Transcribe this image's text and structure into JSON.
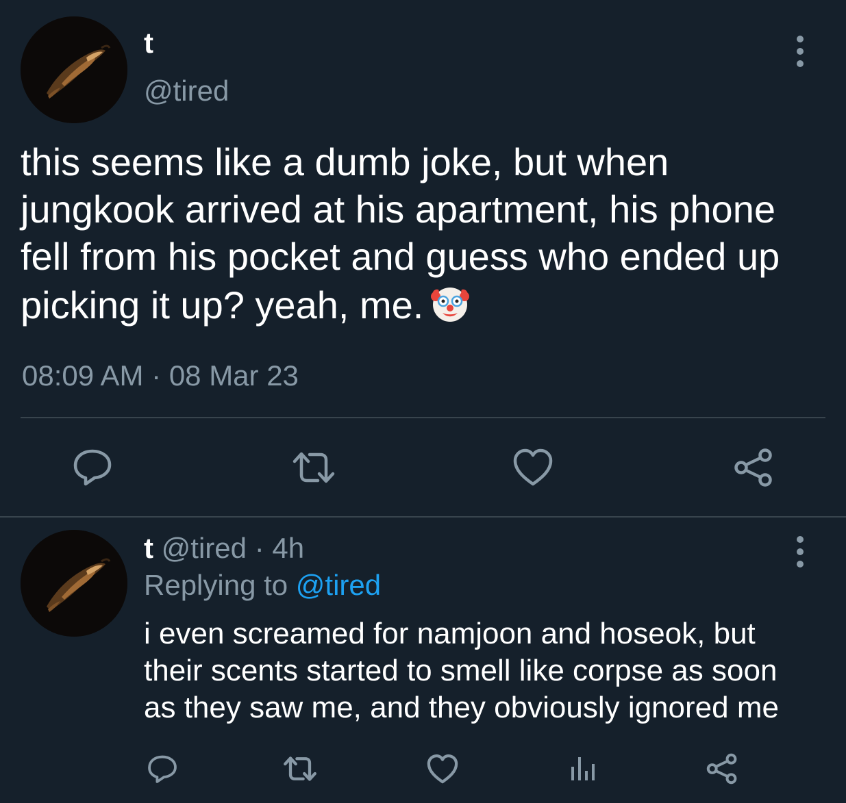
{
  "main_tweet": {
    "display_name": "t",
    "handle": "@tired",
    "text": "this seems like a dumb joke, but when\njungkook arrived at his apartment, his phone\nfell from his pocket and guess who ended up\npicking it up? yeah, me.",
    "emoji": "clown-face-icon",
    "time": "08:09 AM",
    "separator": "·",
    "date": "08 Mar 23",
    "actions": [
      "reply-icon",
      "retweet-icon",
      "like-icon",
      "share-icon"
    ]
  },
  "reply_tweet": {
    "display_name": "t",
    "handle": "@tired",
    "separator": "·",
    "age": "4h",
    "replying_label": "Replying to",
    "replying_to": "@tired",
    "text": "i even screamed for namjoon and hoseok, but\ntheir scents started to smell like corpse as soon\nas they saw me, and they obviously ignored me",
    "actions": [
      "reply-icon",
      "retweet-icon",
      "like-icon",
      "analytics-icon",
      "share-icon"
    ]
  },
  "colors": {
    "background": "#15202b",
    "primary_text": "#ffffff",
    "secondary_text": "#8899a6",
    "divider": "#38444d",
    "link": "#1da1f2"
  }
}
